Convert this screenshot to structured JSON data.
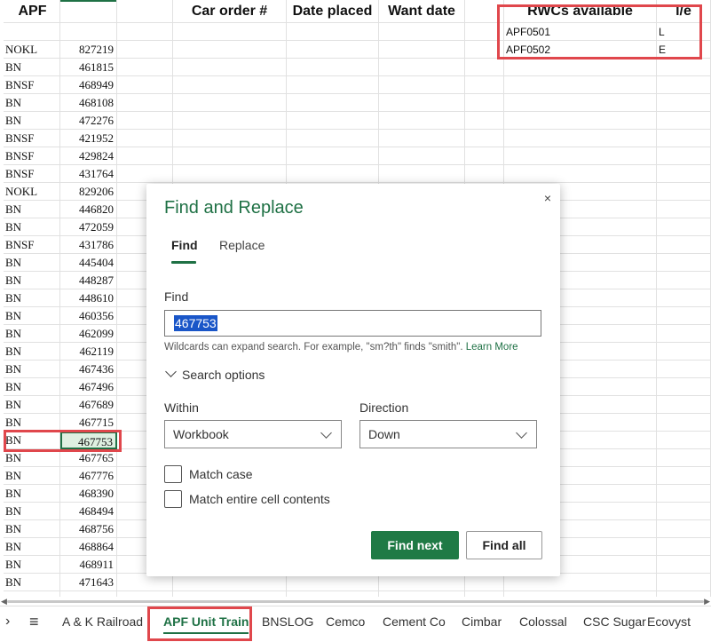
{
  "sheet": {
    "headers": {
      "col_a": "APF",
      "col_car_order": "Car order #",
      "col_date_placed": "Date placed",
      "col_want_date": "Want date",
      "col_rwcs": "RWCs available",
      "col_le": "l/e"
    },
    "rwcs": [
      {
        "name": "APF0501",
        "le": "L"
      },
      {
        "name": "APF0502",
        "le": "E"
      }
    ],
    "rows": [
      {
        "rr": "NOKL",
        "num": "827219"
      },
      {
        "rr": "BN",
        "num": "461815"
      },
      {
        "rr": "BNSF",
        "num": "468949"
      },
      {
        "rr": "BN",
        "num": "468108"
      },
      {
        "rr": "BN",
        "num": "472276"
      },
      {
        "rr": "BNSF",
        "num": "421952"
      },
      {
        "rr": "BNSF",
        "num": "429824"
      },
      {
        "rr": "BNSF",
        "num": "431764"
      },
      {
        "rr": "NOKL",
        "num": "829206"
      },
      {
        "rr": "BN",
        "num": "446820"
      },
      {
        "rr": "BN",
        "num": "472059"
      },
      {
        "rr": "BNSF",
        "num": "431786"
      },
      {
        "rr": "BN",
        "num": "445404"
      },
      {
        "rr": "BN",
        "num": "448287"
      },
      {
        "rr": "BN",
        "num": "448610"
      },
      {
        "rr": "BN",
        "num": "460356"
      },
      {
        "rr": "BN",
        "num": "462099"
      },
      {
        "rr": "BN",
        "num": "462119"
      },
      {
        "rr": "BN",
        "num": "467436"
      },
      {
        "rr": "BN",
        "num": "467496"
      },
      {
        "rr": "BN",
        "num": "467689"
      },
      {
        "rr": "BN",
        "num": "467715"
      },
      {
        "rr": "BN",
        "num": "467753"
      },
      {
        "rr": "BN",
        "num": "467765"
      },
      {
        "rr": "BN",
        "num": "467776"
      },
      {
        "rr": "BN",
        "num": "468390"
      },
      {
        "rr": "BN",
        "num": "468494"
      },
      {
        "rr": "BN",
        "num": "468756"
      },
      {
        "rr": "BN",
        "num": "468864"
      },
      {
        "rr": "BN",
        "num": "468911"
      },
      {
        "rr": "BN",
        "num": "471643"
      }
    ],
    "selected_row_index": 22
  },
  "dialog": {
    "title": "Find and Replace",
    "close_glyph": "×",
    "tabs": {
      "find": "Find",
      "replace": "Replace"
    },
    "find_label": "Find",
    "find_value": "467753",
    "hint_text": "Wildcards can expand search. For example, \"sm?th\" finds \"smith\".",
    "learn_more": "Learn More",
    "search_options": "Search options",
    "within_label": "Within",
    "within_value": "Workbook",
    "direction_label": "Direction",
    "direction_value": "Down",
    "match_case": "Match case",
    "match_entire": "Match entire cell contents",
    "find_next": "Find next",
    "find_all": "Find all"
  },
  "tabbar": {
    "nav_glyph": "›",
    "menu_glyph": "≡",
    "sheets": [
      {
        "label": "A & K Railroad",
        "active": false
      },
      {
        "label": "APF Unit Train",
        "active": true
      },
      {
        "label": "BNSLOG",
        "active": false
      },
      {
        "label": "Cemco",
        "active": false
      },
      {
        "label": "Cement Co",
        "active": false
      },
      {
        "label": "Cimbar",
        "active": false
      },
      {
        "label": "Colossal",
        "active": false
      },
      {
        "label": "CSC Sugar",
        "active": false
      },
      {
        "label": "Ecovyst",
        "active": false
      }
    ]
  },
  "colors": {
    "accent": "#1f7145",
    "highlight_box": "#e0474c",
    "selection_fill": "#dff0e1"
  }
}
